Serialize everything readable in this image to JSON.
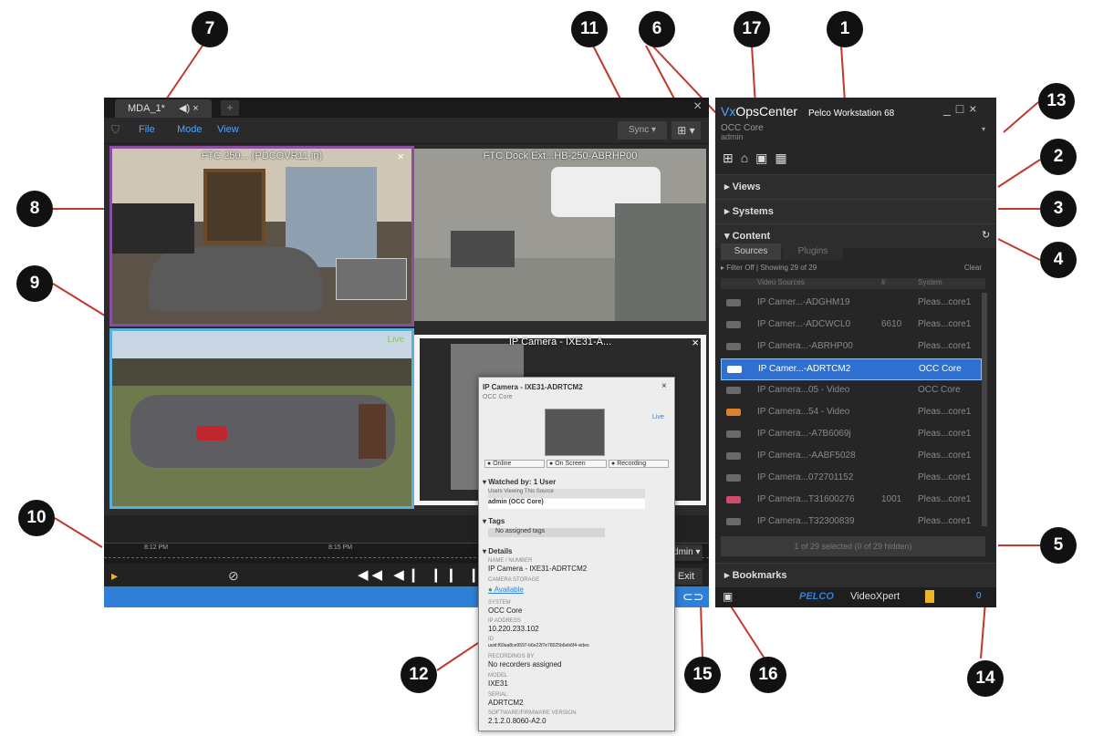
{
  "callouts": [
    "7",
    "11",
    "6",
    "17",
    "1",
    "13",
    "8",
    "2",
    "3",
    "9",
    "4",
    "5",
    "10",
    "12",
    "15",
    "16",
    "14"
  ],
  "window": {
    "tab_label": "MDA_1*",
    "tab_audio": "◀) ×",
    "menu_file": "File",
    "menu_mode": "Mode",
    "menu_view": "View",
    "sync_label": "Sync ▾",
    "close_symbol": "×"
  },
  "tiles": [
    {
      "label": "FTC 250... (PDCOVR11 in)",
      "close": "×"
    },
    {
      "label": "FTC Dock Ext...HB-250-ABRHP00",
      "close": ""
    },
    {
      "label": "",
      "live": "Live"
    },
    {
      "label": "IP Camera - IXE31-A...",
      "close": "×"
    }
  ],
  "timeline": {
    "time_left": "8:12 PM",
    "time_mid": "8:15 PM",
    "user_dropdown": "admin ▾",
    "exit_label": "Exit"
  },
  "popup": {
    "title": "IP Camera - IXE31-ADRTCM2",
    "subtitle": "OCC Core",
    "link": "Live",
    "status_online": "Online",
    "status_onscreen": "On Screen",
    "status_recording": "Recording",
    "watched_header": "Watched by: 1 User",
    "users_viewing_label": "Users Viewing This Source",
    "users_viewing_value": "admin (OCC Core)",
    "tags_header": "Tags",
    "tags_value": "No assigned tags",
    "details_header": "Details",
    "name_label": "NAME / NUMBER",
    "name_value": "IP Camera - IXE31-ADRTCM2",
    "storage_label": "CAMERA STORAGE",
    "storage_value": "Available",
    "system_label": "SYSTEM",
    "system_value": "OCC Core",
    "ip_label": "IP ADDRESS",
    "ip_value": "10.220.233.102",
    "id_label": "ID",
    "id_value": "uuid:f69aa8ce9597-b6e22f7e78025b6eb6f4-video",
    "orders_label": "RECORDINGS BY",
    "orders_value": "No recorders assigned",
    "model_label": "MODEL",
    "model_value": "IXE31",
    "serial_label": "SERIAL",
    "serial_value": "ADRTCM2",
    "firmware_label": "SOFTWARE/FIRMWARE VERSION",
    "firmware_value": "2.1.2.0.8060-A2.0"
  },
  "panel": {
    "title_vx": "Vx",
    "title_ops": "OpsCenter",
    "workstation": "Pelco Workstation 68",
    "system_name": "OCC Core",
    "user": "admin",
    "section_views": "Views",
    "section_systems": "Systems",
    "section_content": "Content",
    "tab_sources": "Sources",
    "tab_plugins": "Plugins",
    "filter": "Filter Off",
    "showing": "Showing 29 of 29",
    "clear": "Clear",
    "col_video_sources": "Video Sources",
    "col_number": "#",
    "col_system": "System",
    "rows": [
      {
        "name": "IP Camer...-ADGHM19",
        "num": "",
        "system": "Pleas...core1",
        "color": "#6a6a6a"
      },
      {
        "name": "IP Camer...-ADCWCL0",
        "num": "6610",
        "system": "Pleas...core1",
        "color": "#6a6a6a"
      },
      {
        "name": "IP Camera...-ABRHP00",
        "num": "",
        "system": "Pleas...core1",
        "color": "#6a6a6a"
      },
      {
        "name": "IP Camer...-ADRTCM2",
        "num": "",
        "system": "OCC Core",
        "color": "#ffffff"
      },
      {
        "name": "IP Camera...05 - Video",
        "num": "",
        "system": "OCC Core",
        "color": "#6a6a6a"
      },
      {
        "name": "IP Camera...54 - Video",
        "num": "",
        "system": "Pleas...core1",
        "color": "#d9822b"
      },
      {
        "name": "IP Camera...-A7B6069j",
        "num": "",
        "system": "Pleas...core1",
        "color": "#6a6a6a"
      },
      {
        "name": "IP Camera...-AABF5028",
        "num": "",
        "system": "Pleas...core1",
        "color": "#6a6a6a"
      },
      {
        "name": "IP Camera...072701152",
        "num": "",
        "system": "Pleas...core1",
        "color": "#6a6a6a"
      },
      {
        "name": "IP Camera...T31600276",
        "num": "1001",
        "system": "Pleas...core1",
        "color": "#d04a6a"
      },
      {
        "name": "IP Camera...T32300839",
        "num": "",
        "system": "Pleas...core1",
        "color": "#6a6a6a"
      }
    ],
    "selected_summary": "1 of 29 selected (0 of 29 hidden)",
    "section_bookmarks": "Bookmarks",
    "brand_pelco": "PELCO",
    "brand_vx": "VideoXpert",
    "notification_count": "0"
  },
  "colors": {
    "accent": "#2f7fd6",
    "selected_row": "#2f6fd0",
    "tile_border_purple": "#8a4fa0",
    "tile_border_blue": "#5ab0d8"
  }
}
